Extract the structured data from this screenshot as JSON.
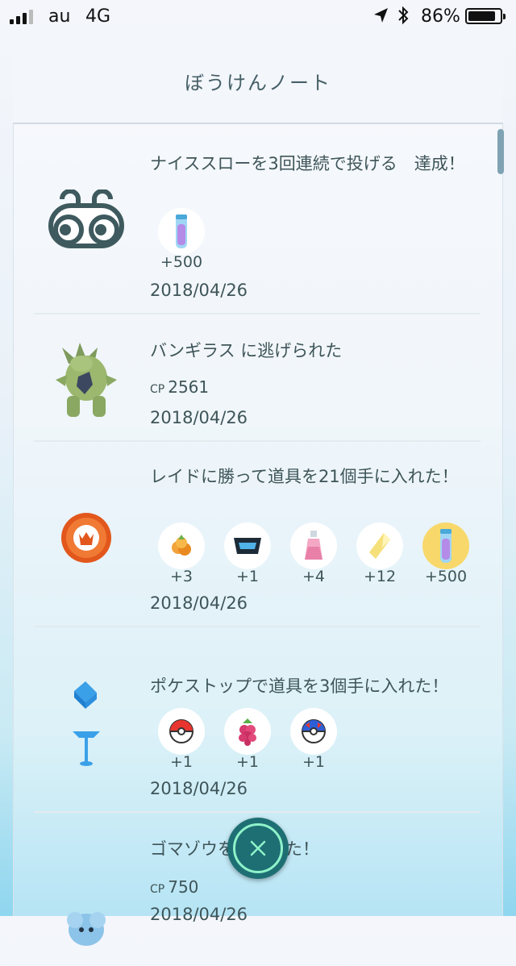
{
  "status_bar": {
    "carrier": "au",
    "network": "4G",
    "battery_percent": "86%",
    "battery_level": 0.86,
    "signal_bars": 3
  },
  "header": {
    "title": "ぼうけんノート"
  },
  "entries": [
    {
      "title": "ナイススローを3回連続で投げる　達成！",
      "icon": "binoculars-icon",
      "items": [
        {
          "icon": "stardust-icon",
          "count": "+500",
          "highlight": false
        }
      ],
      "date": "2018/04/26"
    },
    {
      "title": "バンギラス に逃げられた",
      "icon": "tyranitar-icon",
      "cp_label": "CP",
      "cp_value": "2561",
      "date": "2018/04/26"
    },
    {
      "title": "レイドに勝って道具を21個手に入れた！",
      "icon": "raid-badge-icon",
      "items": [
        {
          "icon": "golden-razz-berry-icon",
          "count": "+3",
          "highlight": false
        },
        {
          "icon": "tm-icon",
          "count": "+1",
          "highlight": false
        },
        {
          "icon": "potion-icon",
          "count": "+4",
          "highlight": false
        },
        {
          "icon": "rare-candy-icon",
          "count": "+12",
          "highlight": false
        },
        {
          "icon": "stardust-icon",
          "count": "+500",
          "highlight": true
        }
      ],
      "date": "2018/04/26"
    },
    {
      "title": "ポケストップで道具を3個手に入れた！",
      "icon": "pokestop-icon",
      "items": [
        {
          "icon": "poke-ball-icon",
          "count": "+1",
          "highlight": false
        },
        {
          "icon": "razz-berry-icon",
          "count": "+1",
          "highlight": false
        },
        {
          "icon": "great-ball-icon",
          "count": "+1",
          "highlight": false
        }
      ],
      "date": "2018/04/26"
    },
    {
      "title": "ゴマゾウを捕まえた！",
      "icon": "phanpy-icon",
      "cp_label": "CP",
      "cp_value": "750",
      "date": "2018/04/26"
    }
  ],
  "close_button": {
    "icon": "close-icon"
  }
}
